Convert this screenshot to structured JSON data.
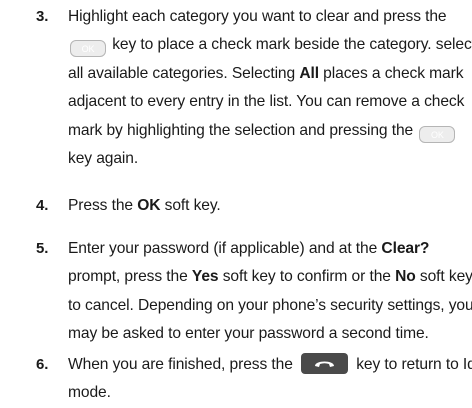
{
  "key_label_ok": "OK",
  "steps": [
    {
      "number": "3.",
      "lines": [
        [
          "Highlight each category you want to clear and press the"
        ],
        [
          "",
          "OK_KEY",
          " key to place a check mark beside the category. select"
        ],
        [
          "all available categories. Selecting ",
          "All",
          " places a check mark"
        ],
        [
          "adjacent to every entry in the list. You can remove a check"
        ],
        [
          "mark by highlighting the selection and pressing the ",
          "OK_KEY"
        ],
        [
          "key again."
        ]
      ],
      "text": {
        "l1": "Highlight each category you want to clear and press the",
        "l2": " key to place a check mark beside the category. select",
        "l3a": "all available categories. Selecting ",
        "l3b": "All",
        "l3c": " places a check mark",
        "l4": "adjacent to every entry in the list. You can remove a check",
        "l5": "mark by highlighting the selection and pressing the ",
        "l6": "key again."
      }
    },
    {
      "number": "4.",
      "text": {
        "a": "Press the ",
        "b": "OK",
        "c": " soft key."
      }
    },
    {
      "number": "5.",
      "text": {
        "l1a": "Enter your password (if applicable) and at the ",
        "l1b": "Clear?",
        "l2a": "prompt, press the ",
        "l2b": "Yes",
        "l2c": " soft key to confirm or the ",
        "l2d": "No",
        "l2e": " soft key",
        "l3": "to cancel. Depending on your phone’s security settings, you",
        "l4": "may be asked to enter your password a second time."
      }
    },
    {
      "number": "6.",
      "text": {
        "l1a": "When you are finished, press the ",
        "l1b": " key to return to Idle",
        "l2": "mode."
      }
    }
  ],
  "icons": {
    "ok_key": "ok-key-icon",
    "end_key": "end-call-key-icon"
  }
}
